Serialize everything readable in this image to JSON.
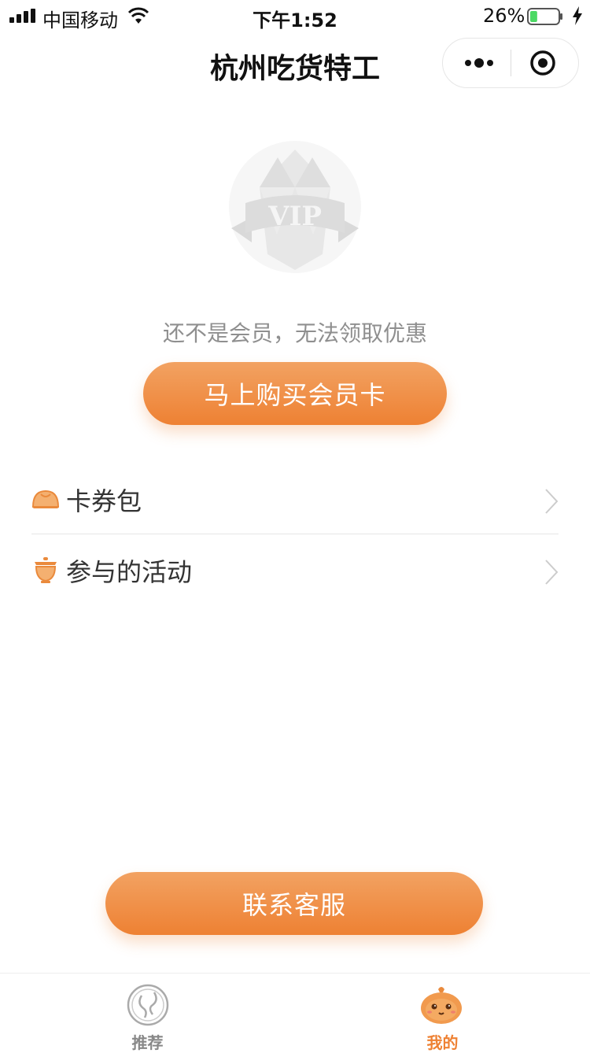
{
  "status_bar": {
    "carrier": "中国移动",
    "time": "下午1:52",
    "battery_percent": "26%",
    "battery_level": 0.26
  },
  "nav": {
    "title": "杭州吃货特工",
    "more_icon": "more-dots-icon",
    "close_icon": "target-close-icon"
  },
  "vip": {
    "badge_text": "VIP",
    "notice": "还不是会员，无法领取优惠",
    "buy_button": "马上购买会员卡"
  },
  "menu": [
    {
      "label": "卡券包",
      "icon": "bun-icon"
    },
    {
      "label": "参与的活动",
      "icon": "teacup-icon"
    }
  ],
  "contact_button": "联系客服",
  "tabs": [
    {
      "label": "推荐",
      "active": false,
      "icon": "recommend-icon"
    },
    {
      "label": "我的",
      "active": true,
      "icon": "mascot-icon"
    }
  ],
  "colors": {
    "accent": "#ee8133",
    "accent_light": "#f2a262",
    "inactive_tab": "#888888",
    "text_muted": "#8f8f8f"
  }
}
